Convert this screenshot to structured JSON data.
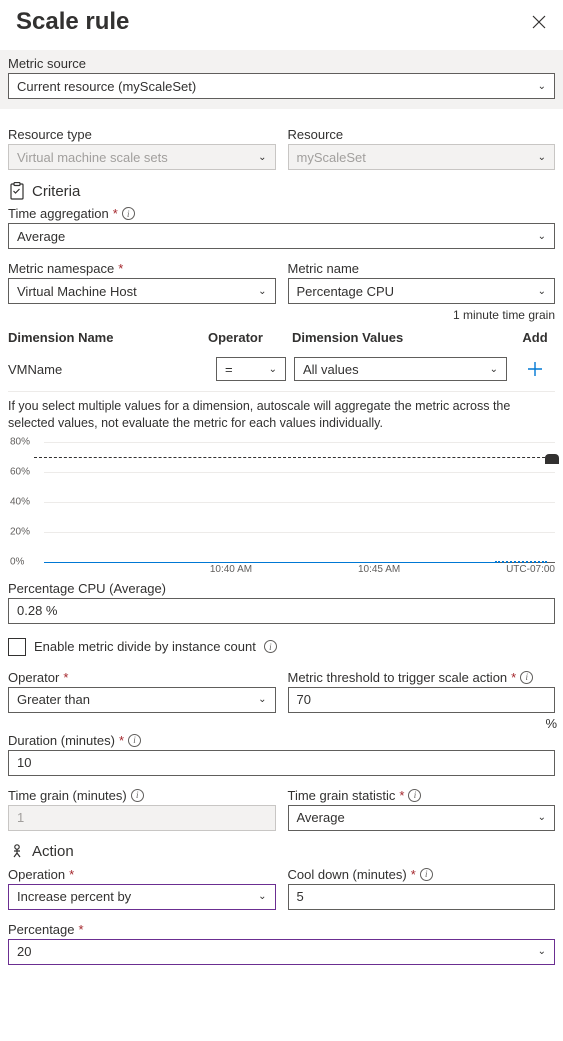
{
  "header": {
    "title": "Scale rule"
  },
  "metric_source": {
    "label": "Metric source",
    "value": "Current resource (myScaleSet)"
  },
  "resource_type": {
    "label": "Resource type",
    "value": "Virtual machine scale sets"
  },
  "resource": {
    "label": "Resource",
    "value": "myScaleSet"
  },
  "criteria": {
    "heading": "Criteria",
    "time_aggregation": {
      "label": "Time aggregation",
      "value": "Average"
    },
    "metric_namespace": {
      "label": "Metric namespace",
      "value": "Virtual Machine Host"
    },
    "metric_name": {
      "label": "Metric name",
      "value": "Percentage CPU",
      "grain_note": "1 minute time grain"
    },
    "dimensions": {
      "headers": {
        "name": "Dimension Name",
        "op": "Operator",
        "val": "Dimension Values",
        "add": "Add"
      },
      "rows": [
        {
          "name": "VMName",
          "op": "=",
          "val": "All values"
        }
      ]
    },
    "hint": "If you select multiple values for a dimension, autoscale will aggregate the metric across the selected values, not evaluate the metric for each values individually.",
    "metric_readout": {
      "label": "Percentage CPU (Average)",
      "value": "0.28 %"
    },
    "divide_checkbox": {
      "label": "Enable metric divide by instance count"
    },
    "operator": {
      "label": "Operator",
      "value": "Greater than"
    },
    "threshold": {
      "label": "Metric threshold to trigger scale action",
      "value": "70",
      "unit": "%"
    },
    "duration": {
      "label": "Duration (minutes)",
      "value": "10"
    },
    "time_grain": {
      "label": "Time grain (minutes)",
      "value": "1"
    },
    "time_grain_stat": {
      "label": "Time grain statistic",
      "value": "Average"
    }
  },
  "action": {
    "heading": "Action",
    "operation": {
      "label": "Operation",
      "value": "Increase percent by"
    },
    "cooldown": {
      "label": "Cool down (minutes)",
      "value": "5"
    },
    "percentage": {
      "label": "Percentage",
      "value": "20"
    }
  },
  "chart_data": {
    "type": "line",
    "title": "",
    "xlabel": "",
    "ylabel": "",
    "ylim": [
      0,
      80
    ],
    "y_ticks": [
      "0%",
      "20%",
      "40%",
      "60%",
      "80%"
    ],
    "x_ticks": [
      "10:40 AM",
      "10:45 AM"
    ],
    "timezone": "UTC-07:00",
    "threshold_line": 70,
    "series": [
      {
        "name": "Percentage CPU",
        "approx_value": 0.28
      }
    ]
  }
}
